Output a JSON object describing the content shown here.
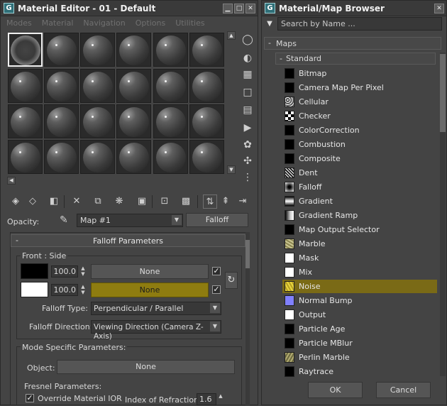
{
  "colors": {
    "accent_selected": "#7a6a16",
    "highlight_yellow": "#8e7c10",
    "panel_bg": "#444444"
  },
  "material_editor": {
    "title": "Material Editor - 01 - Default",
    "app_logo": "G",
    "window_controls": [
      "minimize-icon",
      "restore-icon",
      "close-icon"
    ],
    "menu": [
      "Modes",
      "Material",
      "Navigation",
      "Options",
      "Utilities"
    ],
    "slot_grid": {
      "rows": 4,
      "cols": 6,
      "selected_index": 0
    },
    "side_tools": [
      "sample-type-sphere-icon",
      "backlight-icon",
      "background-checker-icon",
      "sample-uv-tiling-icon",
      "video-color-check-icon",
      "make-preview-icon",
      "options-icon",
      "select-by-material-icon",
      "material-map-navigator-icon"
    ],
    "toolbar_icons": [
      "get-material-icon",
      "put-to-scene-icon",
      "assign-to-selection-icon",
      "reset-map-icon",
      "copy-material-icon",
      "make-unique-icon",
      "put-to-library-icon",
      "material-id-channel-icon",
      "show-shaded-in-viewport-icon",
      "show-end-result-icon",
      "go-to-parent-icon",
      "go-forward-sibling-icon"
    ],
    "opacity_label": "Opacity:",
    "map_name": "Map #1",
    "map_type_button": "Falloff",
    "rollout_title": "Falloff Parameters",
    "rollout_collapse": "-",
    "front_side_label": "Front : Side",
    "front": {
      "value": "100.0",
      "map": "None",
      "enabled": true,
      "swatch": "#000000"
    },
    "side": {
      "value": "100.0",
      "map": "None",
      "enabled": true,
      "swatch": "#ffffff"
    },
    "falloff_type_label": "Falloff Type:",
    "falloff_type": "Perpendicular / Parallel",
    "falloff_direction_label": "Falloff Direction:",
    "falloff_direction": "Viewing Direction (Camera Z-Axis)",
    "mode_specific_label": "Mode Specific Parameters:",
    "object_label": "Object:",
    "object_value": "None",
    "fresnel_label": "Fresnel Parameters:",
    "override_ior_label": "Override Material IOR",
    "override_ior_checked": true,
    "ior_label": "Index of Refraction",
    "ior_value": "1.6"
  },
  "browser": {
    "title": "Material/Map Browser",
    "search_placeholder": "Search by Name ...",
    "category": "Maps",
    "category_toggle": "-",
    "subcategory": "Standard",
    "subcategory_toggle": "-",
    "items": [
      {
        "label": "Bitmap",
        "thumb": "black"
      },
      {
        "label": "Camera Map Per Pixel",
        "thumb": "black"
      },
      {
        "label": "Cellular",
        "thumb": "cellular"
      },
      {
        "label": "Checker",
        "thumb": "checker"
      },
      {
        "label": "ColorCorrection",
        "thumb": "black"
      },
      {
        "label": "Combustion",
        "thumb": "black"
      },
      {
        "label": "Composite",
        "thumb": "black"
      },
      {
        "label": "Dent",
        "thumb": "dent"
      },
      {
        "label": "Falloff",
        "thumb": "falloff"
      },
      {
        "label": "Gradient",
        "thumb": "gradient"
      },
      {
        "label": "Gradient Ramp",
        "thumb": "ramp"
      },
      {
        "label": "Map Output Selector",
        "thumb": "black"
      },
      {
        "label": "Marble",
        "thumb": "marble"
      },
      {
        "label": "Mask",
        "thumb": "white"
      },
      {
        "label": "Mix",
        "thumb": "white"
      },
      {
        "label": "Noise",
        "thumb": "noise",
        "selected": true
      },
      {
        "label": "Normal Bump",
        "thumb": "normal"
      },
      {
        "label": "Output",
        "thumb": "white"
      },
      {
        "label": "Particle Age",
        "thumb": "black"
      },
      {
        "label": "Particle MBlur",
        "thumb": "black"
      },
      {
        "label": "Perlin Marble",
        "thumb": "perlin"
      },
      {
        "label": "Raytrace",
        "thumb": "black"
      }
    ],
    "ok_label": "OK",
    "cancel_label": "Cancel"
  }
}
